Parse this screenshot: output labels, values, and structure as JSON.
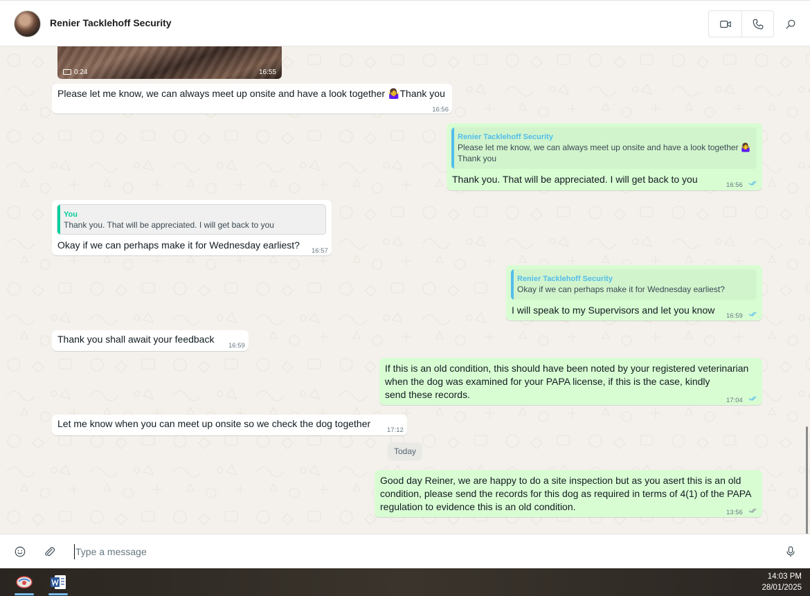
{
  "header": {
    "contact_name": "Renier Tacklehoff Security",
    "video_call_icon": "video-camera-icon",
    "voice_call_icon": "phone-icon",
    "search_icon": "search-icon"
  },
  "messages": [
    {
      "direction": "in",
      "type": "video",
      "duration": "0:24",
      "time": "16:55"
    },
    {
      "direction": "in",
      "text": "Please let me know, we can always meet up onsite and have a look together 🤷‍♀️Thank you",
      "time": "16:56"
    },
    {
      "direction": "out",
      "quote_name": "Renier Tacklehoff Security",
      "quote_line1": "Please let me know, we can always meet up onsite and have a look together 🤷‍♀️",
      "quote_line2": "Thank you",
      "text": "Thank you. That will be appreciated. I will get back to you",
      "time": "16:56",
      "status": "read"
    },
    {
      "direction": "in",
      "quote_name": "You",
      "quote_line1": "Thank you. That will be appreciated. I will get back to you",
      "text": "Okay if we can perhaps make it for Wednesday earliest?",
      "time": "16:57"
    },
    {
      "direction": "out",
      "quote_name": "Renier Tacklehoff Security",
      "quote_line1": "Okay if we can perhaps make it for Wednesday earliest?",
      "text": "I will speak to my Supervisors and let you know",
      "time": "16:59",
      "status": "read"
    },
    {
      "direction": "in",
      "text": "Thank you shall await your feedback",
      "time": "16:59"
    },
    {
      "direction": "out",
      "line1": "If this is an old condition, this should have been noted by your registered veterinarian",
      "line2": "when the dog was examined for your PAPA license, if this is the case, kindly",
      "line3": "send these records.",
      "time": "17:04",
      "status": "read"
    },
    {
      "direction": "in",
      "text": "Let me know when you can meet up onsite so we check the dog together",
      "time": "17:12"
    },
    {
      "direction": "out",
      "line1": "Good day Reiner, we are happy to do a site inspection but as you asert this is an old",
      "line2": "condition, please send the records for this dog as required in terms of 4(1) of the PAPA",
      "line3": "regulation to evidence this is an old condition.",
      "time": "13:56",
      "status": "delivered"
    }
  ],
  "date_separator": "Today",
  "composer": {
    "placeholder": "Type a message",
    "value": "",
    "emoji_icon": "emoji-icon",
    "attach_icon": "paperclip-icon",
    "mic_icon": "microphone-icon"
  },
  "taskbar": {
    "apps": [
      {
        "name": "Messaging app",
        "icon": "app-icon"
      },
      {
        "name": "Word",
        "icon": "word-icon"
      }
    ],
    "time": "14:03 PM",
    "date": "28/01/2025"
  },
  "colors": {
    "outgoing_bubble": "#d9fdd3",
    "incoming_bubble": "#ffffff",
    "quote_bar_you": "#06cf9c",
    "quote_bar_contact": "#53bdeb",
    "read_ticks": "#53bdeb"
  }
}
